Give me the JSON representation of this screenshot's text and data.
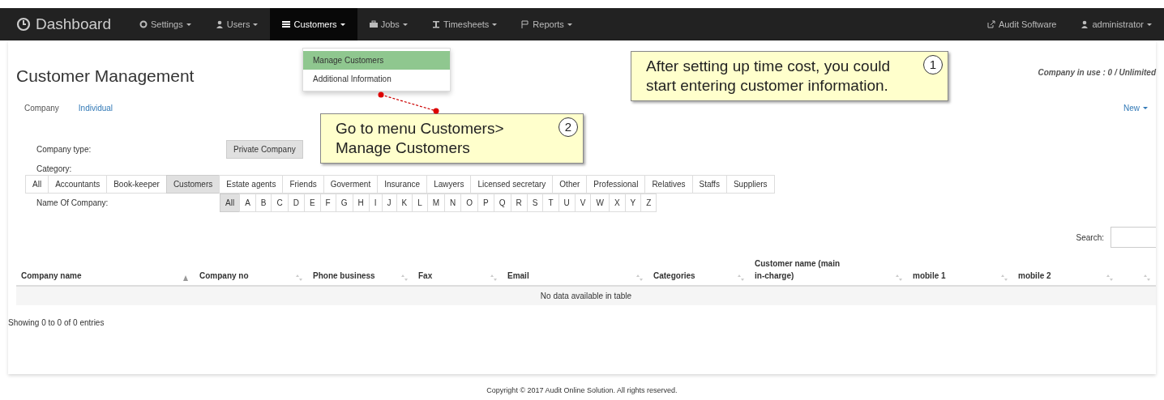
{
  "navbar": {
    "brand": "Dashboard",
    "items": [
      {
        "label": "Settings",
        "selected": false
      },
      {
        "label": "Users",
        "selected": false
      },
      {
        "label": "Customers",
        "selected": true
      },
      {
        "label": "Jobs",
        "selected": false
      },
      {
        "label": "Timesheets",
        "selected": false
      },
      {
        "label": "Reports",
        "selected": false
      }
    ],
    "right_items": [
      "Audit Software",
      "administrator"
    ]
  },
  "dropdown": {
    "items": [
      {
        "label": "Manage Customers",
        "selected": true
      },
      {
        "label": "Additional Information",
        "selected": false
      }
    ]
  },
  "callouts": [
    {
      "number": "1",
      "text": "After setting up time cost, you could start entering customer information."
    },
    {
      "number": "2",
      "text": "Go to menu Customers> Manage Customers"
    }
  ],
  "title": "Customer Management",
  "company_in_use": "Company in use : 0 / Unlimited",
  "tabs": [
    {
      "label": "Company",
      "selected": true
    },
    {
      "label": "Individual",
      "selected": false
    }
  ],
  "new_button": "New",
  "company_type": {
    "label": "Company type:",
    "options": [
      {
        "label": "Private Company",
        "selected": true
      }
    ]
  },
  "category": {
    "label": "Category:",
    "options": [
      {
        "label": "All",
        "selected": false
      },
      {
        "label": "Accountants",
        "selected": false
      },
      {
        "label": "Book-keeper",
        "selected": false
      },
      {
        "label": "Customers",
        "selected": true
      },
      {
        "label": "Estate agents",
        "selected": false
      },
      {
        "label": "Friends",
        "selected": false
      },
      {
        "label": "Goverment",
        "selected": false
      },
      {
        "label": "Insurance",
        "selected": false
      },
      {
        "label": "Lawyers",
        "selected": false
      },
      {
        "label": "Licensed secretary",
        "selected": false
      },
      {
        "label": "Other",
        "selected": false
      },
      {
        "label": "Professional",
        "selected": false
      },
      {
        "label": "Relatives",
        "selected": false
      },
      {
        "label": "Staffs",
        "selected": false
      },
      {
        "label": "Suppliers",
        "selected": false
      }
    ]
  },
  "name_filter": {
    "label": "Name Of Company:",
    "letters": [
      {
        "label": "All",
        "selected": true
      },
      {
        "label": "A",
        "selected": false
      },
      {
        "label": "B",
        "selected": false
      },
      {
        "label": "C",
        "selected": false
      },
      {
        "label": "D",
        "selected": false
      },
      {
        "label": "E",
        "selected": false
      },
      {
        "label": "F",
        "selected": false
      },
      {
        "label": "G",
        "selected": false
      },
      {
        "label": "H",
        "selected": false
      },
      {
        "label": "I",
        "selected": false
      },
      {
        "label": "J",
        "selected": false
      },
      {
        "label": "K",
        "selected": false
      },
      {
        "label": "L",
        "selected": false
      },
      {
        "label": "M",
        "selected": false
      },
      {
        "label": "N",
        "selected": false
      },
      {
        "label": "O",
        "selected": false
      },
      {
        "label": "P",
        "selected": false
      },
      {
        "label": "Q",
        "selected": false
      },
      {
        "label": "R",
        "selected": false
      },
      {
        "label": "S",
        "selected": false
      },
      {
        "label": "T",
        "selected": false
      },
      {
        "label": "U",
        "selected": false
      },
      {
        "label": "V",
        "selected": false
      },
      {
        "label": "W",
        "selected": false
      },
      {
        "label": "X",
        "selected": false
      },
      {
        "label": "Y",
        "selected": false
      },
      {
        "label": "Z",
        "selected": false
      }
    ]
  },
  "search": {
    "label": "Search:"
  },
  "table": {
    "columns": [
      "Company name",
      "Company no",
      "Phone business",
      "Fax",
      "Email",
      "Categories",
      "Customer name (main in-charge)",
      "mobile 1",
      "mobile 2"
    ],
    "empty_message": "No data available in table",
    "info": "Showing 0 to 0 of 0 entries"
  },
  "footer": "Copyright © 2017 Audit Online Solution. All rights reserved."
}
